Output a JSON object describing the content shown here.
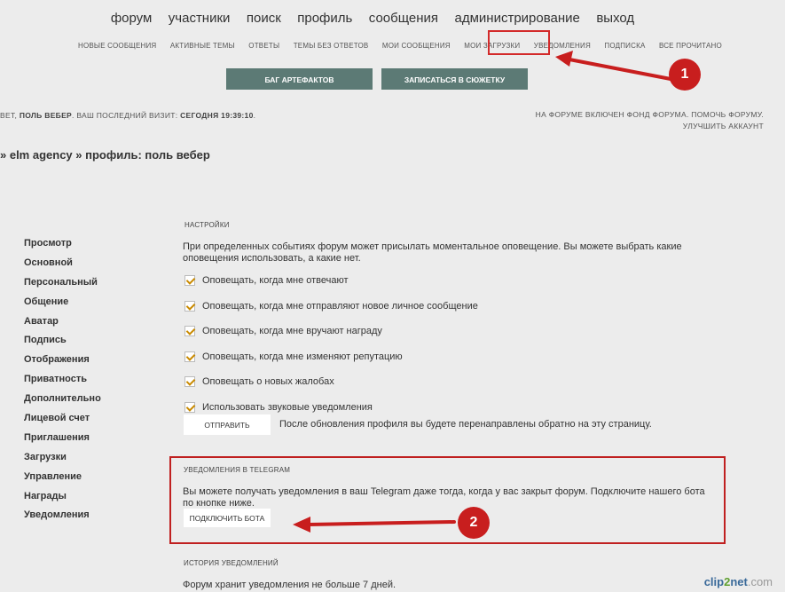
{
  "nav": {
    "main": [
      "форум",
      "участники",
      "поиск",
      "профиль",
      "сообщения",
      "администрирование",
      "выход"
    ],
    "sub": [
      "новые сообщения",
      "активные темы",
      "ответы",
      "темы без ответов",
      "мои сообщения",
      "мои загрузки",
      "уведомления",
      "подписка",
      "все прочитано"
    ]
  },
  "buttons": {
    "artifacts": "БАГ АРТЕФАКТОВ",
    "storyline": "ЗАПИСАТЬСЯ В СЮЖЕТКУ"
  },
  "user_line": {
    "prefix": "ВЕТ, ",
    "name": "ПОЛЬ ВЕБЕР",
    "mid": ". ВАШ ПОСЛЕДНИЙ ВИЗИТ: ",
    "visit": "СЕГОДНЯ 19:39:10",
    "end": "."
  },
  "right_info": {
    "line1": "НА ФОРУМЕ ВКЛЮЧЕН ФОНД ФОРУМА. ПОМОЧЬ ФОРУМУ.",
    "line2": "УЛУЧШИТЬ АККАУНТ"
  },
  "breadcrumb": "» elm agency » профиль: поль вебер",
  "left_menu": [
    "Просмотр",
    "Основной",
    "Персональный",
    "Общение",
    "Аватар",
    "Подпись",
    "Отображения",
    "Приватность",
    "Дополнительно",
    "Лицевой счет",
    "Приглашения",
    "Загрузки",
    "Управление",
    "Награды",
    "Уведомления"
  ],
  "settings": {
    "title": "НАСТРОЙКИ",
    "intro": "При определенных событиях форум может присылать моментальное оповещение. Вы можете выбрать какие оповещения использовать, а какие нет.",
    "options": [
      "Оповещать, когда мне отвечают",
      "Оповещать, когда мне отправляют новое личное сообщение",
      "Оповещать, когда мне вручают награду",
      "Оповещать, когда мне изменяют репутацию",
      "Оповещать о новых жалобах",
      "Использовать звуковые уведомления"
    ],
    "submit": "ОТПРАВИТЬ",
    "submit_note": "После обновления профиля вы будете перенаправлены обратно на эту страницу."
  },
  "telegram": {
    "title": "УВЕДОМЛЕНИЯ В TELEGRAM",
    "text": "Вы можете получать уведомления в ваш Telegram даже тогда, когда у вас закрыт форум. Подключите нашего бота по кнопке ниже.",
    "connect": "ПОДКЛЮЧИТЬ БОТА"
  },
  "history": {
    "title": "ИСТОРИЯ УВЕДОМЛЕНИЙ",
    "text": "Форум хранит уведомления не больше 7 дней."
  },
  "annotations": {
    "badge1": "1",
    "badge2": "2"
  },
  "watermark": {
    "part1": "clip",
    "part2": "2",
    "part3": "net",
    "part4": ".com"
  },
  "colors": {
    "accent": "#5c7a75",
    "highlight": "#d32a2a",
    "check": "#c98a00"
  }
}
